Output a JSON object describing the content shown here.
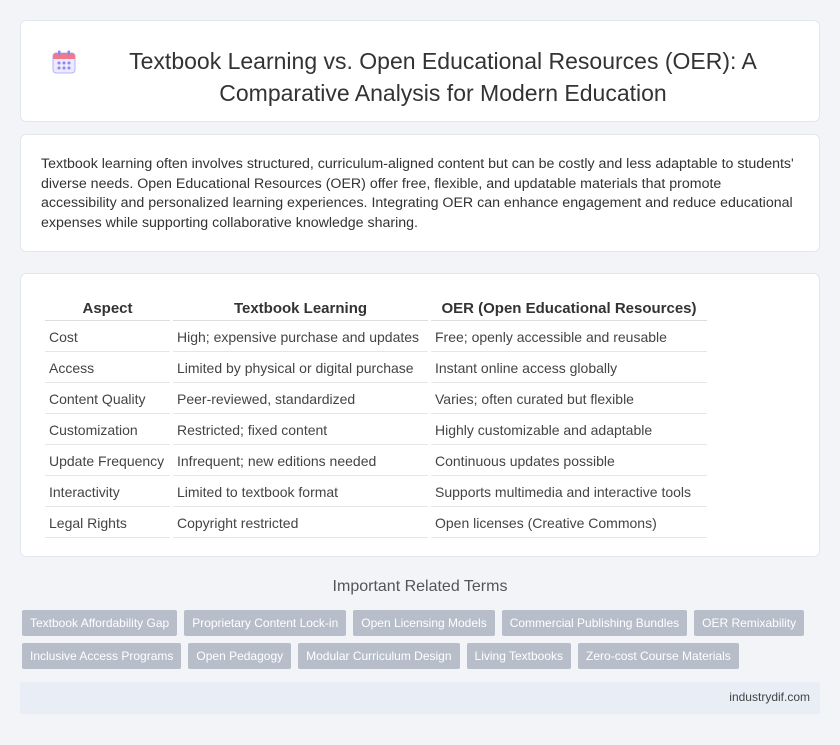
{
  "header": {
    "title": "Textbook Learning vs. Open Educational Resources (OER): A Comparative Analysis for Modern Education",
    "icon": "calendar-icon"
  },
  "intro": {
    "text": "Textbook learning often involves structured, curriculum-aligned content but can be costly and less adaptable to students' diverse needs. Open Educational Resources (OER) offer free, flexible, and updatable materials that promote accessibility and personalized learning experiences. Integrating OER can enhance engagement and reduce educational expenses while supporting collaborative knowledge sharing."
  },
  "table": {
    "headers": [
      "Aspect",
      "Textbook Learning",
      "OER (Open Educational Resources)"
    ],
    "rows": [
      [
        "Cost",
        "High; expensive purchase and updates",
        "Free; openly accessible and reusable"
      ],
      [
        "Access",
        "Limited by physical or digital purchase",
        "Instant online access globally"
      ],
      [
        "Content Quality",
        "Peer-reviewed, standardized",
        "Varies; often curated but flexible"
      ],
      [
        "Customization",
        "Restricted; fixed content",
        "Highly customizable and adaptable"
      ],
      [
        "Update Frequency",
        "Infrequent; new editions needed",
        "Continuous updates possible"
      ],
      [
        "Interactivity",
        "Limited to textbook format",
        "Supports multimedia and interactive tools"
      ],
      [
        "Legal Rights",
        "Copyright restricted",
        "Open licenses (Creative Commons)"
      ]
    ]
  },
  "related": {
    "title": "Important Related Terms",
    "tags": [
      "Textbook Affordability Gap",
      "Proprietary Content Lock-in",
      "Open Licensing Models",
      "Commercial Publishing Bundles",
      "OER Remixability",
      "Inclusive Access Programs",
      "Open Pedagogy",
      "Modular Curriculum Design",
      "Living Textbooks",
      "Zero-cost Course Materials"
    ]
  },
  "footer": {
    "text": "industrydif.com"
  },
  "colors": {
    "background": "#f2f4f8",
    "tag": "#b7bec9",
    "footer": "#e8edf6",
    "icon_accent": "#8f86e8"
  }
}
